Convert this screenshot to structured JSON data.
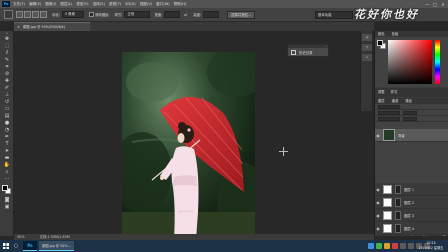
{
  "menubar": {
    "app_icon": "Ps",
    "items": [
      "文件(F)",
      "编辑(E)",
      "图像(I)",
      "图层(L)",
      "类型(Y)",
      "选择(S)",
      "滤镜(T)",
      "3D(D)",
      "视图(V)",
      "窗口(W)",
      "帮助(H)"
    ],
    "window_controls": [
      "—",
      "□",
      "✕"
    ]
  },
  "options_bar": {
    "feather_label": "羽化:",
    "feather_value": "0 像素",
    "antialias_label": "消除锯齿",
    "style_label": "样式:",
    "style_value": "正常",
    "width_label": "宽度:",
    "height_label": "高度:",
    "refine_button": "选择并遮住...",
    "workspace": "基本功能"
  },
  "watermark": "花好你也好",
  "document": {
    "tab_title": "原图.jpg @ 50%(RGB/8#)",
    "status_zoom": "50%",
    "status_size": "文档:1.55M/1.55M"
  },
  "history_dock": {
    "label": "历史记录"
  },
  "right_panel": {
    "color_tabs": [
      "颜色",
      "色板"
    ],
    "adjust_tabs": [
      "调整",
      "样式"
    ],
    "layers_tabs": [
      "图层",
      "通道",
      "路径"
    ],
    "layers": [
      {
        "name": "背景",
        "selected": true
      },
      {
        "name": "图层 1"
      },
      {
        "name": "图层 2"
      },
      {
        "name": "图层 3"
      },
      {
        "name": "图层 4"
      }
    ],
    "bottom_icons": [
      "link-icon",
      "fx-icon",
      "mask-icon",
      "adjustment-icon",
      "folder-icon",
      "new-layer-icon",
      "trash-icon"
    ]
  },
  "taskbar": {
    "ps_label": "Ps",
    "task_label": "原图.jpg @ 50%...",
    "time": "10:24",
    "date": "2019/8/2 星期五"
  },
  "colors": {
    "menubar_bg": "#535353",
    "canvas_bg": "#282828",
    "panel_bg": "#424242",
    "taskbar_bg": "#1c3046",
    "umbrella": "#c8262b"
  }
}
